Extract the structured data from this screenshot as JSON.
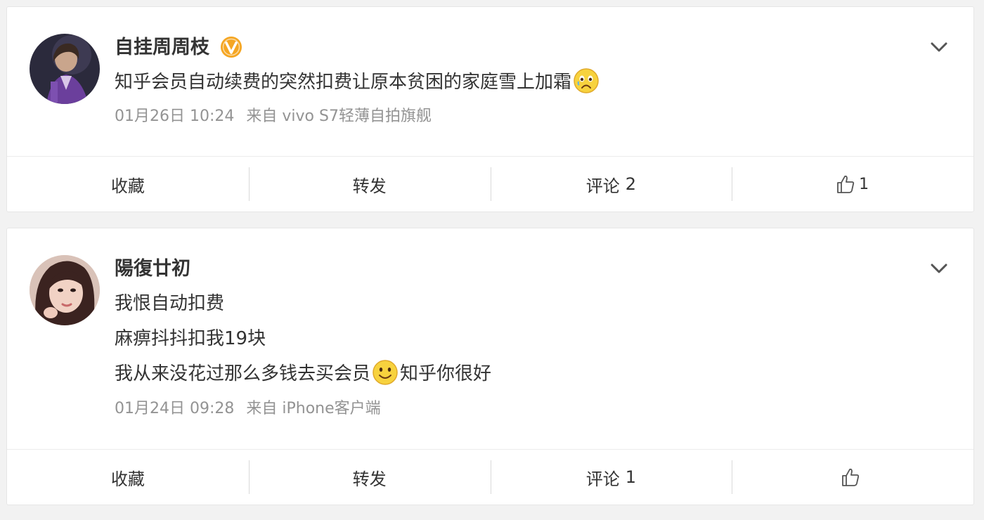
{
  "posts": [
    {
      "username": "自挂周周枝",
      "verified": true,
      "text_parts": [
        "知乎会员自动续费的突然扣费让原本贫困的家庭雪上加霜"
      ],
      "emoji": "sad-face-emoji",
      "time": "01月26日 10:24",
      "source": "来自 vivo S7轻薄自拍旗舰",
      "actions": {
        "favorite": "收藏",
        "repost": "转发",
        "comment_label": "评论",
        "comment_count": "2",
        "like_count": "1"
      }
    },
    {
      "username": "陽復廿初",
      "verified": false,
      "lines": [
        "我恨自动扣费",
        "麻痹抖抖扣我19块"
      ],
      "line3_before": "我从来没花过那么多钱去买会员",
      "line3_after": "知乎你很好",
      "emoji": "smile-face-emoji",
      "time": "01月24日 09:28",
      "source": "来自 iPhone客户端",
      "actions": {
        "favorite": "收藏",
        "repost": "转发",
        "comment_label": "评论",
        "comment_count": "1",
        "like_count": ""
      }
    }
  ],
  "colors": {
    "background": "#f2f2f2",
    "card": "#ffffff",
    "text": "#333333",
    "meta": "#939393",
    "verified_badge": "#f5a623"
  }
}
